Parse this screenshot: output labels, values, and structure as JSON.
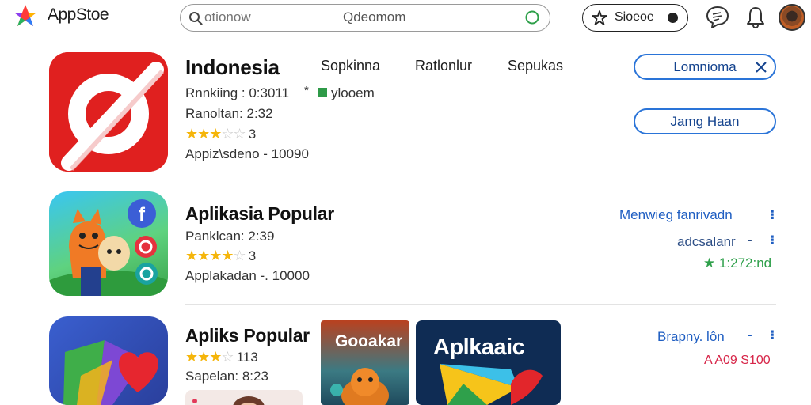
{
  "header": {
    "app_title": "AppStoe",
    "search": {
      "placeholder": "otionow",
      "center_text": "Qdeomom"
    },
    "store_button_label": "Sioeoe",
    "icons": [
      "app-logo-icon",
      "search-icon",
      "go-circle-icon",
      "star-badge-icon",
      "chat-bubble-icon",
      "bell-icon",
      "avatar"
    ]
  },
  "apps": [
    {
      "name": "Indonesia",
      "ranking": "Rnnkiing : 0:3011",
      "ranking_mark": "*",
      "ranking_tag": "ylooem",
      "ranking_tag_color": "#2e9a48",
      "rank_line": "Ranoltan: 2:32",
      "rating": 3.5,
      "rating_count": "3",
      "downloads": "Appiz\\sdeno - 10090",
      "tabs": [
        "Sopkinna",
        "Ratlonlur",
        "Sepukas"
      ],
      "pill_primary": "Lomnioma",
      "pill_secondary": "Jamg Haan",
      "icon": "red-slash-icon",
      "icon_color": "#e0201f"
    },
    {
      "name": "Aplikasia Popular",
      "rank_line": "Panklcan: 2:39",
      "rating": 4.5,
      "rating_count": "3",
      "downloads": "Applakadan -. 10000",
      "link_primary": "Menwieg fanrivadn",
      "link_secondary": "adcsalanr",
      "link_secondary_mark": "-",
      "green_text": "★ 1:272:nd",
      "icon": "cartoon-cat-social-icon"
    },
    {
      "name": "Apliks Popular",
      "rating": 3.5,
      "rating_count": "113",
      "rank_line": "Sapelan: 8:23",
      "link_primary": "Brapny. lôn",
      "link_primary_mark": "-",
      "red_text": "A A09 S100",
      "icon": "blue-heart-icon",
      "promo_left_text": "Gooakar",
      "promo_right_text": "Aplkaaic"
    }
  ],
  "colors": {
    "accent_blue": "#2a74d8",
    "link_blue": "#1f5ec2",
    "star_gold": "#f5b50a",
    "green": "#2fa04b",
    "red": "#d72649"
  }
}
